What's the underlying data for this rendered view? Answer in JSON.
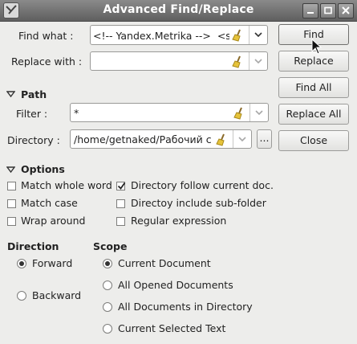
{
  "window": {
    "title": "Advanced Find/Replace"
  },
  "find": {
    "label": "Find what :",
    "value": "<!-- Yandex.Metrika -->  <s"
  },
  "replace": {
    "label": "Replace with :",
    "value": ""
  },
  "buttons": {
    "find": "Find",
    "replace": "Replace",
    "find_all": "Find All",
    "replace_all": "Replace All",
    "close": "Close"
  },
  "path": {
    "heading": "Path",
    "filter_label": "Filter :",
    "filter_value": "*",
    "directory_label": "Directory :",
    "directory_value": "/home/getnaked/Рабочий с",
    "browse_label": "..."
  },
  "options": {
    "heading": "Options",
    "match_whole_word": "Match whole word",
    "match_case": "Match case",
    "wrap_around": "Wrap around",
    "directory_follow": "Directory follow current doc.",
    "directory_subfolder": "Directoy include sub-folder",
    "regular_expression": "Regular expression"
  },
  "direction": {
    "heading": "Direction",
    "forward": "Forward",
    "backward": "Backward"
  },
  "scope": {
    "heading": "Scope",
    "current_document": "Current Document",
    "all_opened": "All Opened Documents",
    "all_in_directory": "All Documents in Directory",
    "current_selected": "Current Selected Text"
  },
  "state": {
    "directory_follow_checked": true,
    "direction_selected": "Forward",
    "scope_selected": "Current Document"
  },
  "colors": {
    "titlebar": "#6e6e6e",
    "window_bg": "#ededeb",
    "title_text": "#ffffff"
  }
}
